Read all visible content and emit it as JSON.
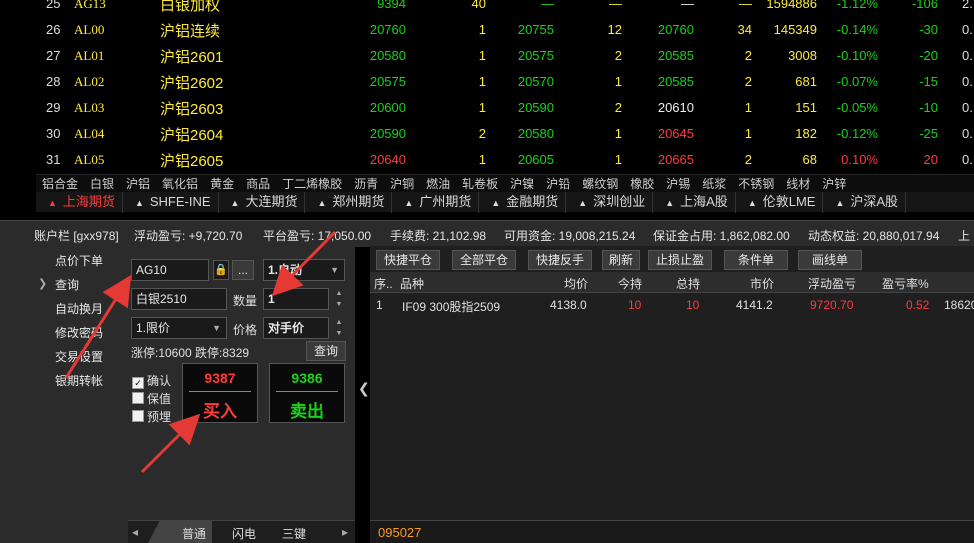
{
  "quotes": [
    {
      "idx": "25",
      "code": "AG13",
      "name": "白银加权",
      "last": "9394",
      "last_color": "green",
      "lvol": "40",
      "bid": "—",
      "bvol": "—",
      "ask": "—",
      "ask_color": "white",
      "avol": "—",
      "vol": "1594886",
      "chg": "-1.12%",
      "chg_color": "green",
      "chgv": "-106",
      "tail": "2."
    },
    {
      "idx": "26",
      "code": "AL00",
      "name": "沪铝连续",
      "last": "20760",
      "last_color": "green",
      "lvol": "1",
      "bid": "20755",
      "bvol": "12",
      "ask": "20760",
      "ask_color": "green",
      "avol": "34",
      "vol": "145349",
      "chg": "-0.14%",
      "chg_color": "green",
      "chgv": "-30",
      "tail": "0."
    },
    {
      "idx": "27",
      "code": "AL01",
      "name": "沪铝2601",
      "last": "20580",
      "last_color": "green",
      "lvol": "1",
      "bid": "20575",
      "bvol": "2",
      "ask": "20585",
      "ask_color": "green",
      "avol": "2",
      "vol": "3008",
      "chg": "-0.10%",
      "chg_color": "green",
      "chgv": "-20",
      "tail": "0."
    },
    {
      "idx": "28",
      "code": "AL02",
      "name": "沪铝2602",
      "last": "20575",
      "last_color": "green",
      "lvol": "1",
      "bid": "20570",
      "bvol": "1",
      "ask": "20585",
      "ask_color": "green",
      "avol": "2",
      "vol": "681",
      "chg": "-0.07%",
      "chg_color": "green",
      "chgv": "-15",
      "tail": "0."
    },
    {
      "idx": "29",
      "code": "AL03",
      "name": "沪铝2603",
      "last": "20600",
      "last_color": "green",
      "lvol": "1",
      "bid": "20590",
      "bvol": "2",
      "ask": "20610",
      "ask_color": "white",
      "avol": "1",
      "vol": "151",
      "chg": "-0.05%",
      "chg_color": "green",
      "chgv": "-10",
      "tail": "0."
    },
    {
      "idx": "30",
      "code": "AL04",
      "name": "沪铝2604",
      "last": "20590",
      "last_color": "green",
      "lvol": "2",
      "bid": "20580",
      "bvol": "1",
      "ask": "20645",
      "ask_color": "red",
      "avol": "1",
      "vol": "182",
      "chg": "-0.12%",
      "chg_color": "green",
      "chgv": "-25",
      "tail": "0."
    },
    {
      "idx": "31",
      "code": "AL05",
      "name": "沪铝2605",
      "last": "20640",
      "last_color": "red",
      "lvol": "1",
      "bid": "20605",
      "bvol": "1",
      "ask": "20665",
      "ask_color": "red",
      "avol": "2",
      "vol": "68",
      "chg": "0.10%",
      "chg_color": "red",
      "chgv": "20",
      "tail": "0."
    }
  ],
  "categories": [
    "铝合金",
    "白银",
    "沪铝",
    "氧化铝",
    "黄金",
    "商品",
    "丁二烯橡胶",
    "沥青",
    "沪铜",
    "燃油",
    "轧卷板",
    "沪镍",
    "沪铅",
    "螺纹钢",
    "橡胶",
    "沪锡",
    "纸浆",
    "不锈钢",
    "线材",
    "沪锌"
  ],
  "exchanges": [
    "上海期货",
    "SHFE-INE",
    "大连期货",
    "郑州期货",
    "广州期货",
    "金融期货",
    "深圳创业",
    "上海A股",
    "伦敦LME",
    "沪深A股"
  ],
  "account": {
    "label": "账户栏 [gxx978]",
    "float_pl": "浮动盈亏: +9,720.70",
    "close_pl": "平台盈亏: 17,050.00",
    "fee": "手续费: 21,102.98",
    "avail": "可用资金: 19,008,215.24",
    "margin": "保证金占用: 1,862,082.00",
    "equity": "动态权益: 20,880,017.94",
    "more": "上"
  },
  "menu": [
    "点价下单",
    "查询",
    "自动换月",
    "修改密码",
    "交易设置",
    "银期转帐"
  ],
  "order": {
    "contract": "AG10",
    "mode": "1.自动",
    "name": "白银2510",
    "qty_label": "数量",
    "qty": "1",
    "ptype": "1.限价",
    "price_label": "价格",
    "price": "对手价",
    "limits": "涨停:10600 跌停:8329",
    "query": "查询",
    "confirm": "确认",
    "hedge": "保值",
    "preorder": "预埋",
    "buy_price": "9387",
    "buy_text": "买入",
    "sell_price": "9386",
    "sell_text": "卖出",
    "tabs": [
      "普通",
      "闪电",
      "三键"
    ],
    "dots": "..."
  },
  "positions": {
    "buttons": [
      "快捷平仓",
      "全部平仓",
      "快捷反手",
      "刷新",
      "止损止盈",
      "条件单",
      "画线单"
    ],
    "headers": [
      "序..",
      "品种",
      "均价",
      "今持",
      "总持",
      "市价",
      "浮动盈亏",
      "盈亏率%"
    ],
    "row": {
      "idx": "1",
      "name": "IF09 300股指2509",
      "avg": "4138.0",
      "today": "10",
      "total": "10",
      "market": "4141.2",
      "float": "9720.70",
      "rate": "0.52",
      "tail": "18620"
    },
    "footer": "095027"
  },
  "colors": {
    "up": "#ff3a3a",
    "down": "#19d219",
    "name": "#ffeb3b",
    "annotation": "#e53935"
  }
}
